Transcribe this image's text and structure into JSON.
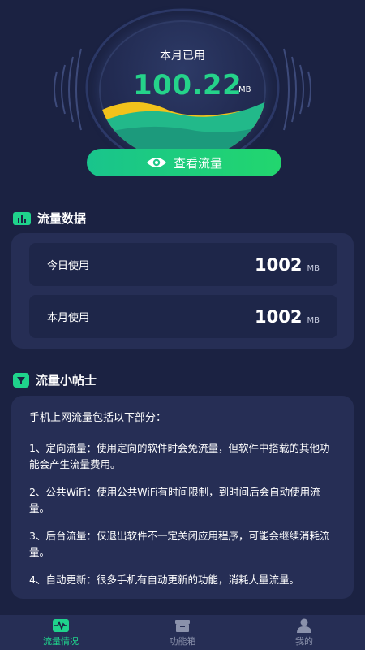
{
  "gauge": {
    "label": "本月已用",
    "value": "100.22",
    "unit": "MB",
    "button_label": "查看流量",
    "button_icon": "eye-icon",
    "accent": "#1fd38c"
  },
  "stats": {
    "title": "流量数据",
    "icon": "bar-chart-icon",
    "rows": [
      {
        "label": "今日使用",
        "value": "1002",
        "unit": "MB"
      },
      {
        "label": "本月使用",
        "value": "1002",
        "unit": "MB"
      }
    ]
  },
  "tips": {
    "title": "流量小帖士",
    "icon": "tip-icon",
    "heading": "手机上网流量包括以下部分：",
    "items": [
      "1、定向流量：使用定向的软件时会免流量，但软件中搭载的其他功能会产生流量费用。",
      "2、公共WiFi：使用公共WiFi有时间限制，到时间后会自动使用流量。",
      "3、后台流量：仅退出软件不一定关闭应用程序，可能会继续消耗流量。",
      "4、自动更新：很多手机有自动更新的功能，消耗大量流量。"
    ]
  },
  "nav": {
    "items": [
      {
        "label": "流量情况",
        "icon": "traffic-icon",
        "active": true
      },
      {
        "label": "功能箱",
        "icon": "toolbox-icon",
        "active": false
      },
      {
        "label": "我的",
        "icon": "user-icon",
        "active": false
      }
    ]
  }
}
